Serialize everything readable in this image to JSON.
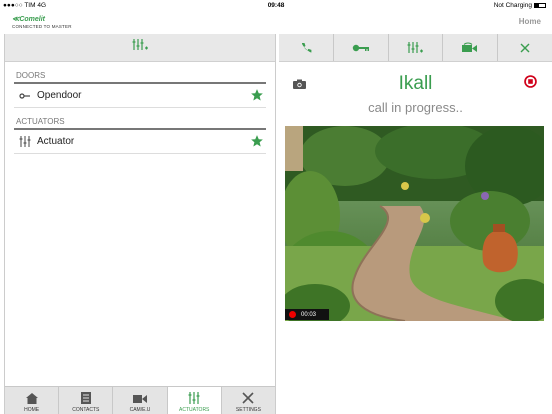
{
  "status_bar": {
    "carrier": "●●●○○ TIM",
    "network": "4G",
    "time": "09:48",
    "charging": "Not Charging"
  },
  "header": {
    "brand": "Comelit",
    "subtitle": "CONNECTED TO MASTER",
    "home_link": "Home"
  },
  "left_panel": {
    "sections": [
      {
        "title": "DOORS",
        "items": [
          {
            "label": "Opendoor",
            "icon": "key-icon",
            "favorite": true
          }
        ]
      },
      {
        "title": "ACTUATORS",
        "items": [
          {
            "label": "Actuator",
            "icon": "sliders-icon",
            "favorite": true
          }
        ]
      }
    ]
  },
  "bottom_nav": [
    {
      "label": "HOME",
      "icon": "home-icon",
      "active": false
    },
    {
      "label": "CONTACTS",
      "icon": "contacts-icon",
      "active": false
    },
    {
      "label": "CAM/E.U",
      "icon": "camera-icon",
      "active": false
    },
    {
      "label": "ACTUATORS",
      "icon": "sliders-icon",
      "active": true
    },
    {
      "label": "SETTINGS",
      "icon": "tools-icon",
      "active": false
    }
  ],
  "call": {
    "name": "Ikall",
    "status": "call in progress..",
    "timer": "00:03"
  },
  "colors": {
    "accent": "#3a9d4f",
    "stop": "#d0021b",
    "toolbar": "#e8e8e8"
  }
}
